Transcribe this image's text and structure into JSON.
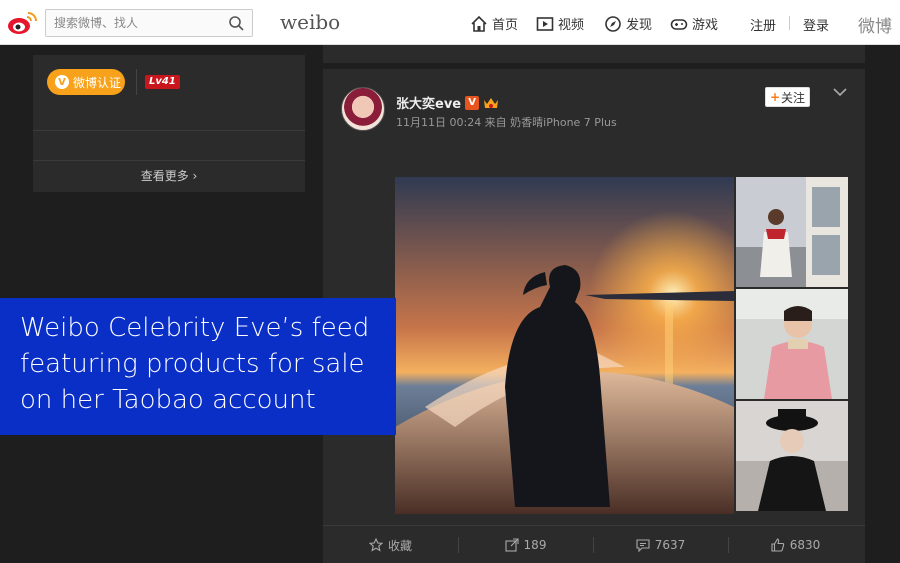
{
  "topbar": {
    "search_placeholder": "搜索微博、找人",
    "brand": "weibo",
    "nav": [
      {
        "label": "首页",
        "icon": "home-icon"
      },
      {
        "label": "视频",
        "icon": "video-icon"
      },
      {
        "label": "发现",
        "icon": "compass-icon"
      },
      {
        "label": "游戏",
        "icon": "gamepad-icon"
      }
    ],
    "register": "注册",
    "login": "登录",
    "right_text": "微博"
  },
  "profile_card": {
    "verify_label": "微博认证",
    "level": "Lv41",
    "see_more": "查看更多 ›"
  },
  "post": {
    "username": "张大奕eve",
    "meta": "11月11日 00:24 来自 奶香晴iPhone 7 Plus",
    "follow_label": "关注",
    "actions": {
      "favorite": "收藏",
      "repost": "189",
      "comment": "7637",
      "like": "6830"
    }
  },
  "caption": {
    "lines": [
      "Weibo Celebrity Eve’s feed",
      "featuring products for sale",
      "on her Taobao account"
    ]
  },
  "colors": {
    "caption_bg": "#0a2fc7",
    "vip_orange": "#f7a21a",
    "level_red": "#c8161d",
    "card_bg": "#2b2b2b"
  }
}
